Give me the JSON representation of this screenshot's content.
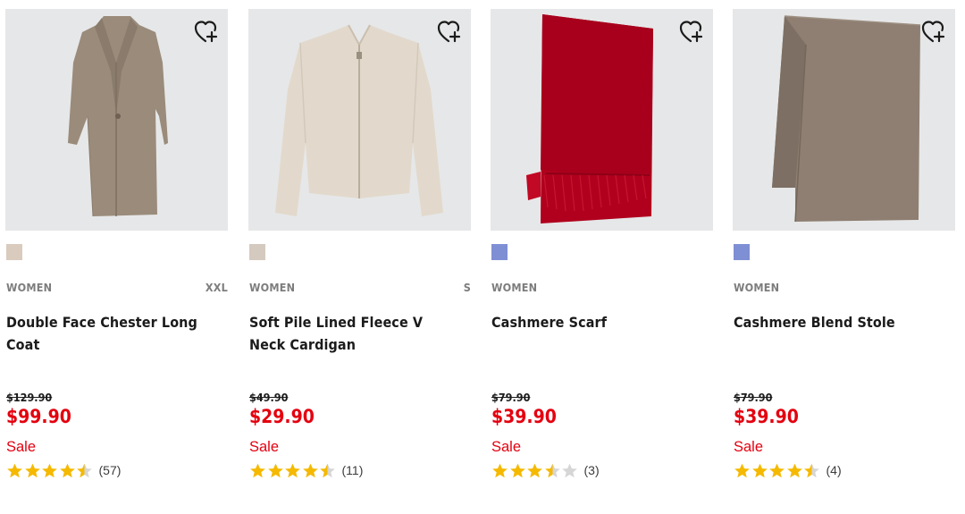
{
  "colors": {
    "sale_red": "#e4000f",
    "star_gold": "#f5b900",
    "image_bg": "#e6e7e8"
  },
  "products": [
    {
      "category": "WOMEN",
      "size": "XXL",
      "name": "Double Face Chester Long Coat",
      "original_price": "$129.90",
      "price": "$99.90",
      "sale_label": "Sale",
      "rating": 4.5,
      "review_count": "(57)",
      "swatch_color": "#d9cbbe",
      "image_icon": "coat-image",
      "wishlist_icon": "heart-plus-icon"
    },
    {
      "category": "WOMEN",
      "size": "S",
      "name": "Soft Pile Lined Fleece V Neck Cardigan",
      "original_price": "$49.90",
      "price": "$29.90",
      "sale_label": "Sale",
      "rating": 4.5,
      "review_count": "(11)",
      "swatch_color": "#d5cabf",
      "image_icon": "cardigan-image",
      "wishlist_icon": "heart-plus-icon"
    },
    {
      "category": "WOMEN",
      "size": "",
      "name": "Cashmere Scarf",
      "original_price": "$79.90",
      "price": "$39.90",
      "sale_label": "Sale",
      "rating": 3.5,
      "review_count": "(3)",
      "swatch_color": "#7f8fd4",
      "image_icon": "scarf-image",
      "wishlist_icon": "heart-plus-icon"
    },
    {
      "category": "WOMEN",
      "size": "",
      "name": "Cashmere Blend Stole",
      "original_price": "$79.90",
      "price": "$39.90",
      "sale_label": "Sale",
      "rating": 4.5,
      "review_count": "(4)",
      "swatch_color": "#7f8fd4",
      "image_icon": "stole-image",
      "wishlist_icon": "heart-plus-icon"
    }
  ]
}
